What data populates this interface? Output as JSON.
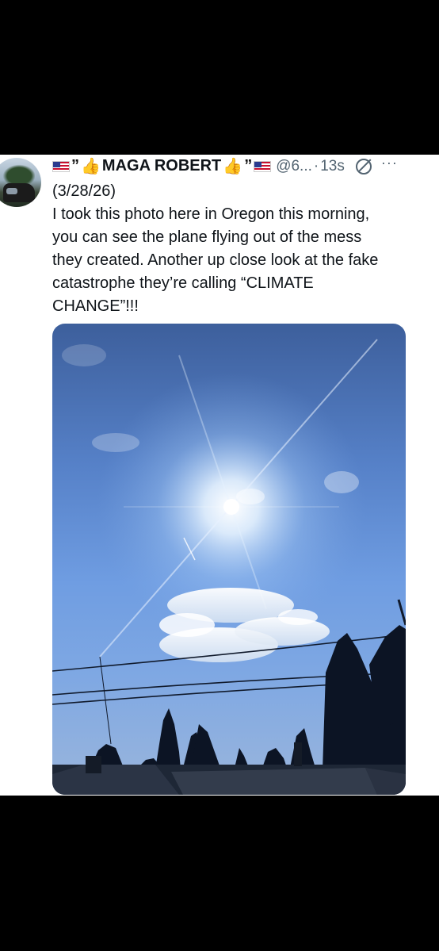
{
  "post": {
    "author": {
      "prefix_quote": "”",
      "name": "MAGA ROBERT",
      "suffix_quote": "”",
      "handle": "@6...",
      "dot": "·",
      "time": "13s"
    },
    "lines": [
      "(3/28/26)",
      "I took this photo here in Oregon this morning,",
      "you can see the plane flying out of the mess",
      "they created. Another up close look at the fake",
      "catastrophe they’re calling “CLIMATE",
      "CHANGE”!!!"
    ],
    "more_icon_glyph": "···",
    "thumb_glyph": "👍"
  },
  "icons": [
    "us-flag-icon",
    "thumbs-up-icon",
    "mute-icon",
    "more-icon"
  ]
}
